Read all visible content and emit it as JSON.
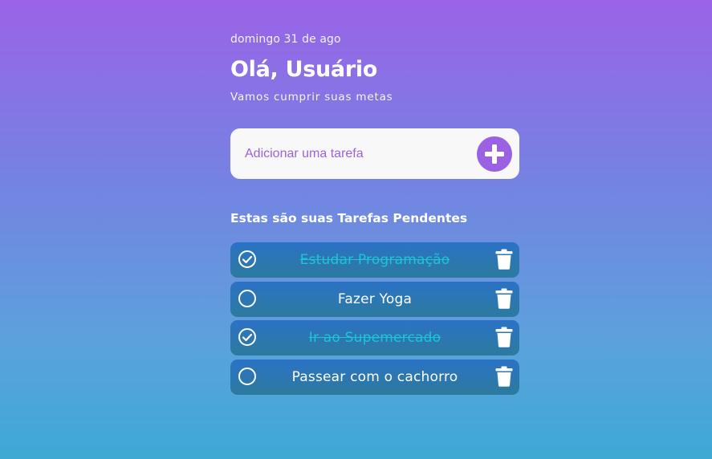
{
  "header": {
    "date": "domingo 31 de ago",
    "greeting": "Olá, Usuário",
    "subtitle": "Vamos cumprir suas metas"
  },
  "add_task": {
    "placeholder": "Adicionar uma tarefa",
    "button_icon": "plus-circle-icon"
  },
  "tasks_section": {
    "title": "Estas são suas Tarefas Pendentes"
  },
  "tasks": [
    {
      "label": "Estudar Programação",
      "done": true
    },
    {
      "label": "Fazer Yoga",
      "done": false
    },
    {
      "label": "Ir ao Supemercado",
      "done": true
    },
    {
      "label": "Passear com o cachorro",
      "done": false
    }
  ],
  "colors": {
    "accent": "#9b61e3",
    "done_text": "#1ec4d4",
    "task_bg": "#2b72c6"
  },
  "icons": {
    "check": "check-circle-icon",
    "unchecked": "empty-circle-icon",
    "delete": "trash-icon"
  }
}
